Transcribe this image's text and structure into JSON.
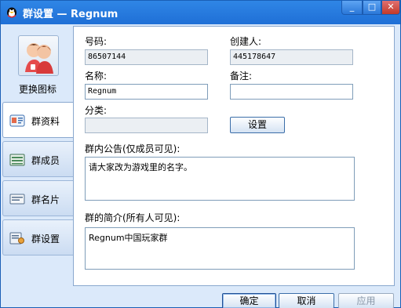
{
  "window": {
    "title": "群设置 — Regnum",
    "min_glyph": "_",
    "max_glyph": "□",
    "close_glyph": "✕"
  },
  "sidebar": {
    "change_icon_label": "更换图标",
    "items": [
      {
        "label": "群资料",
        "icon": "group-info-icon",
        "active": true
      },
      {
        "label": "群成员",
        "icon": "members-icon",
        "active": false
      },
      {
        "label": "群名片",
        "icon": "card-icon",
        "active": false
      },
      {
        "label": "群设置",
        "icon": "settings-icon",
        "active": false
      }
    ]
  },
  "form": {
    "number_label": "号码:",
    "number_value": "86507144",
    "creator_label": "创建人:",
    "creator_value": "445178647",
    "name_label": "名称:",
    "name_value": "Regnum",
    "note_label": "备注:",
    "note_value": "",
    "category_label": "分类:",
    "category_value": "",
    "set_button": "设置",
    "announcement_label": "群内公告(仅成员可见):",
    "announcement_value": "请大家改为游戏里的名字。",
    "intro_label": "群的简介(所有人可见):",
    "intro_value": "Regnum中国玩家群"
  },
  "footer": {
    "ok": "确定",
    "cancel": "取消",
    "apply": "应用"
  },
  "colors": {
    "title_bar": "#1f6fd6",
    "window_bg": "#dbe9fa",
    "border": "#8aa8cf"
  }
}
